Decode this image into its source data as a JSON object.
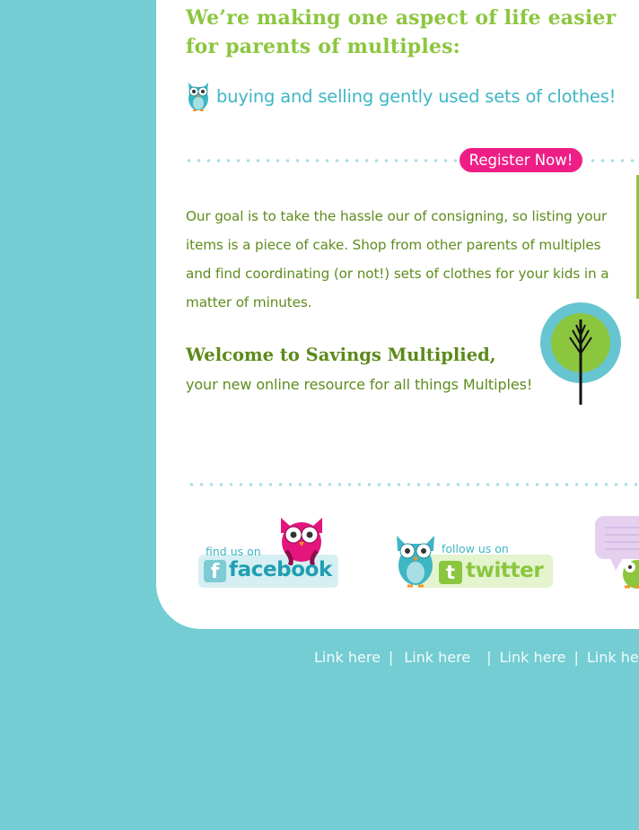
{
  "headline": "We’re making one aspect of life easier for parents of multiples:",
  "tagline": "buying and selling gently used sets of clothes!",
  "register_button": "Register Now!",
  "goal_text": "Our goal is to take the hassle our of consigning, so listing your items is a piece of cake. Shop from other parents of multiples and find coordinating (or not!) sets of clothes for your kids in a matter of minutes.",
  "welcome": {
    "title": "Welcome to Savings Multiplied,",
    "subtitle": "your new online resource for all things Multiples!"
  },
  "social": {
    "facebook": {
      "small": "find us on",
      "name": "facebook"
    },
    "twitter": {
      "small": "follow us on",
      "name": "twitter"
    }
  },
  "footer": {
    "links": [
      "Link here",
      "Link here",
      "Link here",
      "Link here"
    ],
    "separator": "|"
  },
  "colors": {
    "background": "#73cdd2",
    "headline_green": "#8cc63f",
    "text_green": "#5e8c1e",
    "teal": "#3eb6c4",
    "register_pink": "#ee1e86"
  },
  "icons": [
    "owl-icon",
    "tree-icon",
    "facebook-f-icon",
    "twitter-t-icon",
    "speech-bubble-icon"
  ]
}
